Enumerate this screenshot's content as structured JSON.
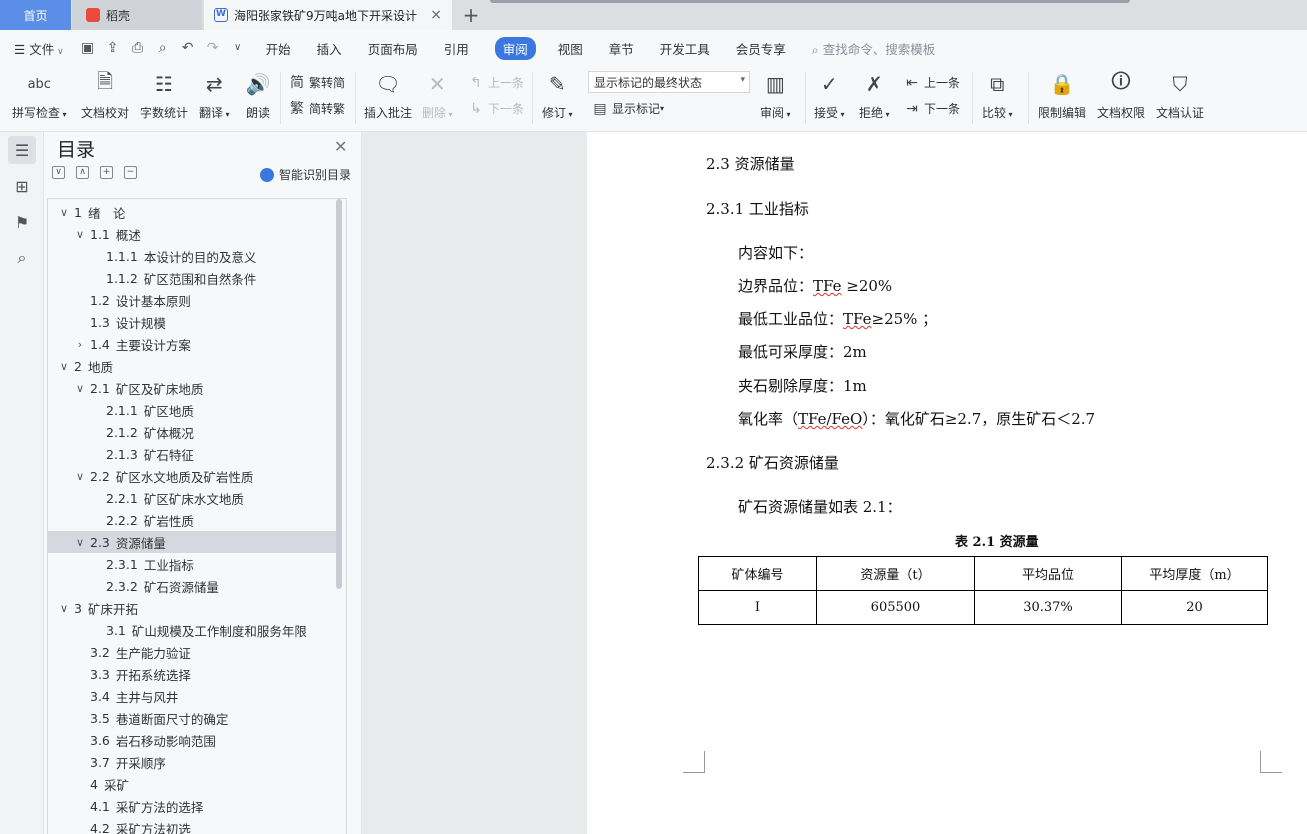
{
  "tabs": {
    "home": "首页",
    "daoke": "稻壳",
    "doc": "海阳张家铁矿9万吨a地下开采设计",
    "close": "×",
    "add": "+"
  },
  "menubar": {
    "file": "文件",
    "tabs": [
      "开始",
      "插入",
      "页面布局",
      "引用",
      "审阅",
      "视图",
      "章节",
      "开发工具",
      "会员专享"
    ],
    "active_tab": "审阅",
    "search": "查找命令、搜索模板"
  },
  "ribbon": {
    "spell_check": "拼写检查",
    "doc_proof": "文档校对",
    "word_count": "字数统计",
    "translate": "翻译",
    "read_aloud": "朗读",
    "trad_to_simp": "繁转简",
    "simp_to_trad": "简转繁",
    "insert_comment": "插入批注",
    "delete": "删除",
    "prev_comment": "上一条",
    "next_comment": "下一条",
    "revise": "修订",
    "markup_state": "显示标记的最终状态",
    "show_markup": "显示标记",
    "review": "审阅",
    "accept": "接受",
    "reject": "拒绝",
    "prev_change": "上一条",
    "next_change": "下一条",
    "compare": "比较",
    "restrict_edit": "限制编辑",
    "doc_permission": "文档权限",
    "doc_cert": "文档认证",
    "abc": "abc"
  },
  "toc": {
    "title": "目录",
    "ai_label": "智能识别目录",
    "items": [
      {
        "num": "1",
        "text": "绪　论",
        "level": 0,
        "chev": "v"
      },
      {
        "num": "1.1",
        "text": "概述",
        "level": 1,
        "chev": "v"
      },
      {
        "num": "1.1.1",
        "text": "本设计的目的及意义",
        "level": 2,
        "chev": ""
      },
      {
        "num": "1.1.2",
        "text": "矿区范围和自然条件",
        "level": 2,
        "chev": ""
      },
      {
        "num": "1.2",
        "text": "设计基本原则",
        "level": 1,
        "chev": ""
      },
      {
        "num": "1.3",
        "text": "设计规模",
        "level": 1,
        "chev": ""
      },
      {
        "num": "1.4",
        "text": "主要设计方案",
        "level": 1,
        "chev": ">"
      },
      {
        "num": "2",
        "text": "地质",
        "level": 0,
        "chev": "v"
      },
      {
        "num": "2.1",
        "text": "矿区及矿床地质",
        "level": 1,
        "chev": "v"
      },
      {
        "num": "2.1.1",
        "text": "矿区地质",
        "level": 2,
        "chev": ""
      },
      {
        "num": "2.1.2",
        "text": "矿体概况",
        "level": 2,
        "chev": ""
      },
      {
        "num": "2.1.3",
        "text": "矿石特征",
        "level": 2,
        "chev": ""
      },
      {
        "num": "2.2",
        "text": "矿区水文地质及矿岩性质",
        "level": 1,
        "chev": "v"
      },
      {
        "num": "2.2.1",
        "text": "矿区矿床水文地质",
        "level": 2,
        "chev": ""
      },
      {
        "num": "2.2.2",
        "text": "矿岩性质",
        "level": 2,
        "chev": ""
      },
      {
        "num": "2.3",
        "text": "资源储量",
        "level": 1,
        "chev": "v",
        "selected": true
      },
      {
        "num": "2.3.1",
        "text": "工业指标",
        "level": 2,
        "chev": ""
      },
      {
        "num": "2.3.2",
        "text": "矿石资源储量",
        "level": 2,
        "chev": ""
      },
      {
        "num": "3",
        "text": "矿床开拓",
        "level": 0,
        "chev": "v"
      },
      {
        "num": "3.1",
        "text": "矿山规模及工作制度和服务年限",
        "level": 2,
        "chev": ""
      },
      {
        "num": "3.2",
        "text": "生产能力验证",
        "level": 1,
        "chev": ""
      },
      {
        "num": "3.3",
        "text": "开拓系统选择",
        "level": 1,
        "chev": ""
      },
      {
        "num": "3.4",
        "text": "主井与风井",
        "level": 1,
        "chev": ""
      },
      {
        "num": "3.5",
        "text": "巷道断面尺寸的确定",
        "level": 1,
        "chev": ""
      },
      {
        "num": "3.6",
        "text": "岩石移动影响范围",
        "level": 1,
        "chev": ""
      },
      {
        "num": "3.7",
        "text": "开采顺序",
        "level": 1,
        "chev": ""
      },
      {
        "num": "4",
        "text": "采矿",
        "level": 1,
        "chev": ""
      },
      {
        "num": "4.1",
        "text": "采矿方法的选择",
        "level": 1,
        "chev": ""
      },
      {
        "num": "4.2",
        "text": "采矿方法初选",
        "level": 1,
        "chev": ""
      }
    ]
  },
  "document": {
    "h_2_3": "2.3  资源储量",
    "h_2_3_1": "2.3.1  工业指标",
    "intro": "内容如下：",
    "line1_pre": "边界品位：",
    "line1_tfe": "TFe",
    "line1_post": "  ≥20%",
    "line2_pre": "最低工业品位：",
    "line2_tfe": "TFe",
    "line2_post": "≥25% ；",
    "line3": "最低可采厚度：2m",
    "line4": "夹石剔除厚度：1m",
    "line5_pre": "氧化率（",
    "line5_tfe": "TFe/FeO",
    "line5_post": "）：氧化矿石≥2.7，原生矿石＜2.7",
    "h_2_3_2": "2.3.2  矿石资源储量",
    "table_intro": "矿石资源储量如表 2.1：",
    "caption": "表 2.1  资源量",
    "table": {
      "headers": [
        "矿体编号",
        "资源量（t）",
        "平均品位",
        "平均厚度（m）"
      ],
      "rows": [
        [
          "I",
          "605500",
          "30.37%",
          "20"
        ]
      ]
    }
  }
}
